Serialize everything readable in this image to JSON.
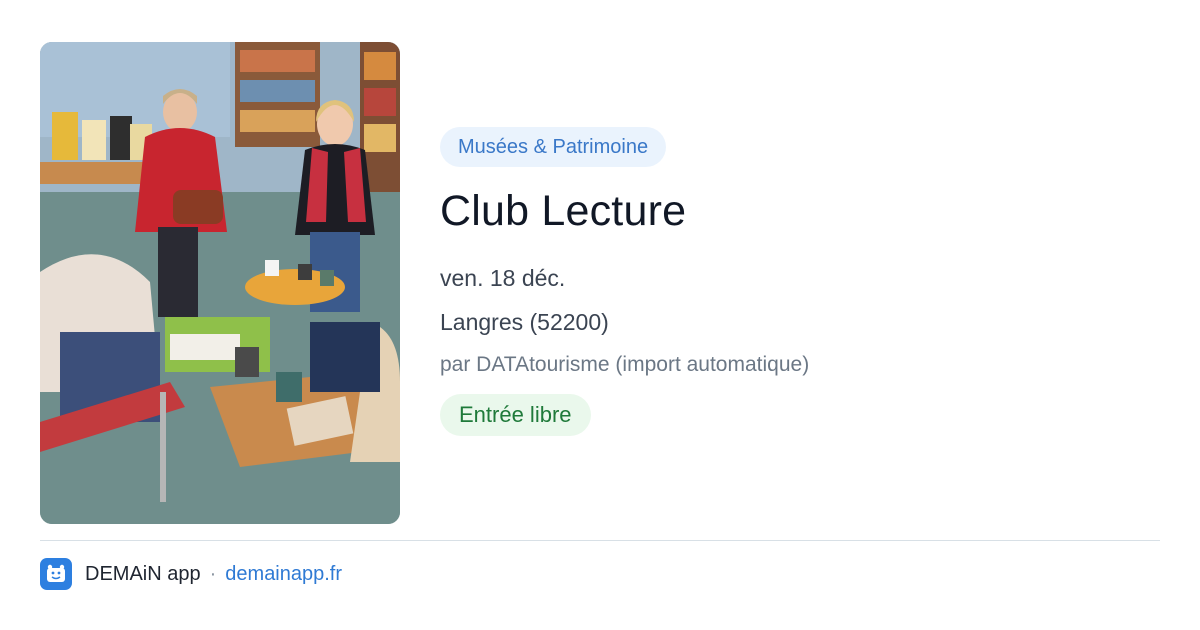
{
  "event": {
    "image_alt": "Club Lecture photo",
    "category": "Musées & Patrimoine",
    "title": "Club Lecture",
    "date": "ven. 18 déc.",
    "location": "Langres (52200)",
    "source": "par DATAtourisme (import automatique)",
    "price": "Entrée libre"
  },
  "footer": {
    "app_icon": "demain-app-logo-icon",
    "app_name": "DEMAiN app",
    "separator": "·",
    "link": "demainapp.fr"
  },
  "colors": {
    "category_badge_bg": "#eaf3fd",
    "category_badge_text": "#3a78c8",
    "price_badge_bg": "#eaf8ec",
    "price_badge_text": "#1f7a3a",
    "link": "#2f7ad4",
    "app_logo": "#2d7fe0"
  }
}
